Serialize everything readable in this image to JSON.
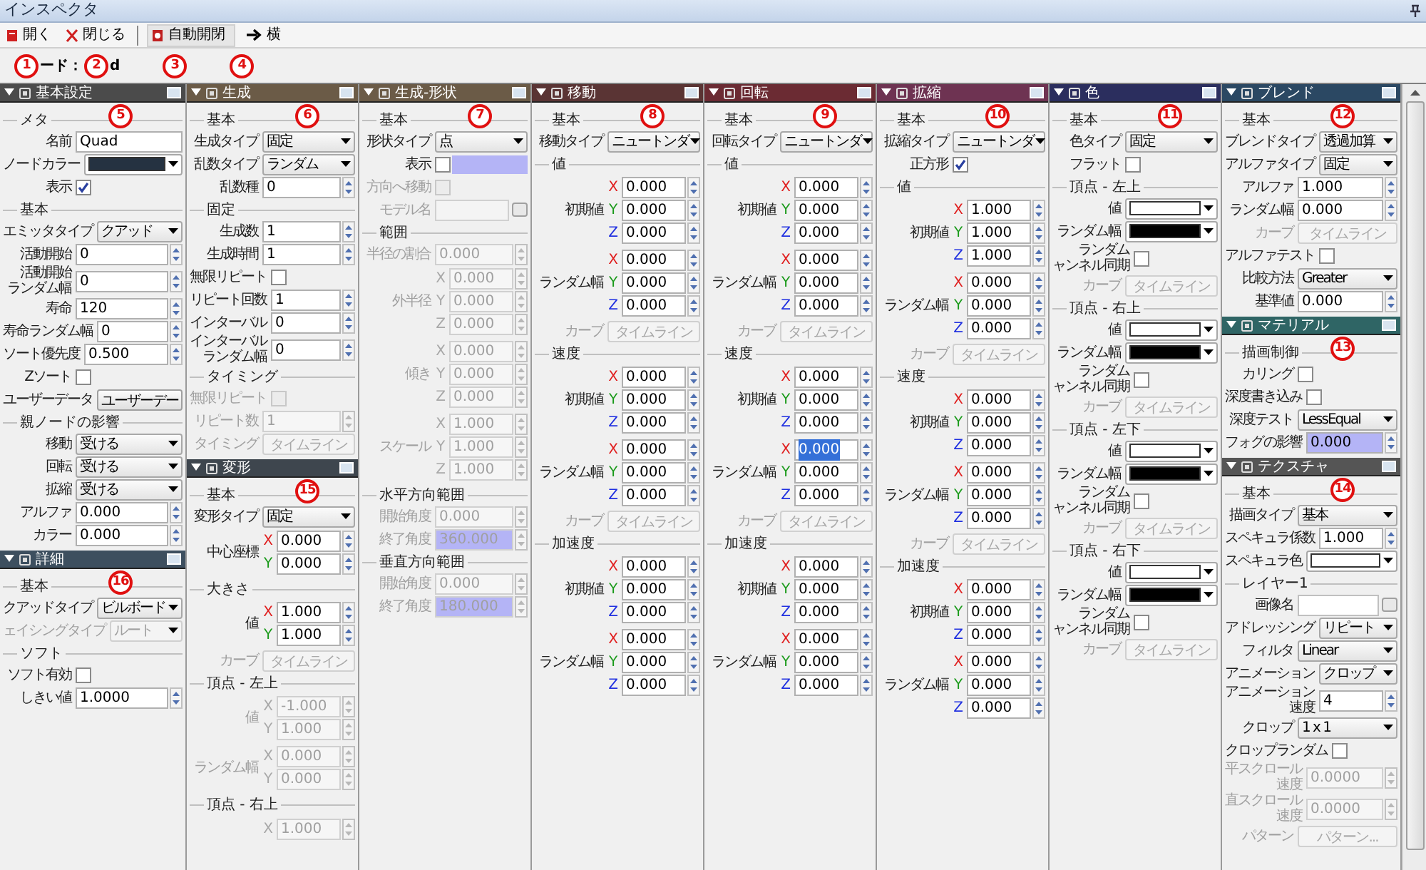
{
  "window": {
    "title": "インスペクタ"
  },
  "toolbar": [
    {
      "label": "開く",
      "kind": "open"
    },
    {
      "label": "閉じる",
      "kind": "close"
    },
    {
      "label": "自動開閉",
      "kind": "auto"
    },
    {
      "label": "横",
      "kind": "arrow"
    }
  ],
  "node_row": [
    {
      "kind": "callout",
      "text": "1"
    },
    {
      "kind": "text",
      "text": "ード："
    },
    {
      "kind": "callout",
      "text": "2"
    },
    {
      "kind": "text",
      "text": "d"
    },
    {
      "kind": "callout",
      "text": "3"
    },
    {
      "kind": "callout",
      "text": "4"
    }
  ],
  "columns": [
    {
      "panels": [
        {
          "title": "基本設定",
          "callout": "5",
          "color": "#4b4b4b",
          "expanded": true,
          "sections": [
            {
              "heading": "メタ",
              "rows": [
                {
                  "kind": "text",
                  "label": "名前",
                  "value": "Quad"
                },
                {
                  "kind": "color",
                  "label": "ノードカラー",
                  "color": "#253241"
                },
                {
                  "kind": "check",
                  "label": "表示",
                  "checked": true
                }
              ]
            },
            {
              "heading": "基本",
              "rows": [
                {
                  "kind": "select",
                  "label": "エミッタタイプ",
                  "value": "クアッド"
                },
                {
                  "kind": "spin",
                  "label": "活動開始",
                  "value": "0"
                },
                {
                  "kind": "spin",
                  "label": [
                    "活動開始",
                    "ランダム幅"
                  ],
                  "value": "0"
                },
                {
                  "kind": "spin",
                  "label": "寿命",
                  "value": "120"
                },
                {
                  "kind": "spin",
                  "label": "寿命ランダム幅",
                  "value": "0"
                },
                {
                  "kind": "spin",
                  "label": "ソート優先度",
                  "value": "0.500"
                },
                {
                  "kind": "check",
                  "label": "Zソート",
                  "checked": false
                },
                {
                  "kind": "button",
                  "label": "ユーザーデータ",
                  "value": "ユーザーデー"
                }
              ]
            },
            {
              "heading": "親ノードの影響",
              "rows": [
                {
                  "kind": "select",
                  "label": "移動",
                  "value": "受ける"
                },
                {
                  "kind": "select",
                  "label": "回転",
                  "value": "受ける"
                },
                {
                  "kind": "select",
                  "label": "拡縮",
                  "value": "受ける"
                },
                {
                  "kind": "spin",
                  "label": "アルファ",
                  "value": "0.000"
                },
                {
                  "kind": "spin",
                  "label": "カラー",
                  "value": "0.000"
                }
              ]
            }
          ]
        },
        {
          "title": "詳細",
          "callout": "16",
          "color": "#3d4f5f",
          "expanded": true,
          "sections": [
            {
              "heading": "基本",
              "rows": [
                {
                  "kind": "select",
                  "label": "クアッドタイプ",
                  "value": "ビルボード"
                },
                {
                  "kind": "select",
                  "label": "ェイシングタイプ",
                  "value": "ルート",
                  "disabled": true
                }
              ]
            },
            {
              "heading": "ソフト",
              "rows": [
                {
                  "kind": "check",
                  "label": "ソフト有効",
                  "checked": false
                },
                {
                  "kind": "spin",
                  "label": "しきい値",
                  "value": "1.0000"
                }
              ]
            }
          ]
        }
      ]
    },
    {
      "panels": [
        {
          "title": "生成",
          "callout": "6",
          "color": "#6b5b47",
          "expanded": true,
          "sections": [
            {
              "heading": "基本",
              "rows": [
                {
                  "kind": "select",
                  "label": "生成タイプ",
                  "value": "固定"
                },
                {
                  "kind": "select",
                  "label": "乱数タイプ",
                  "value": "ランダム"
                },
                {
                  "kind": "spin",
                  "label": "乱数種",
                  "value": "0"
                }
              ]
            },
            {
              "heading": "固定",
              "rows": [
                {
                  "kind": "spin",
                  "label": "生成数",
                  "value": "1"
                },
                {
                  "kind": "spin",
                  "label": "生成時間",
                  "value": "1"
                },
                {
                  "kind": "check",
                  "label": "無限リピート",
                  "checked": false
                },
                {
                  "kind": "spin",
                  "label": "リピート回数",
                  "value": "1"
                },
                {
                  "kind": "spin",
                  "label": "インターバル",
                  "value": "0"
                },
                {
                  "kind": "spin",
                  "label": [
                    "インターバル",
                    "ランダム幅"
                  ],
                  "value": "0"
                }
              ]
            },
            {
              "heading": "タイミング",
              "rows": [
                {
                  "kind": "check",
                  "label": "無限リピート",
                  "checked": false,
                  "disabled": true
                },
                {
                  "kind": "spin",
                  "label": "リピート数",
                  "value": "1",
                  "disabled": true
                },
                {
                  "kind": "button",
                  "label": "タイミング",
                  "value": "タイムライン",
                  "disabled": true
                }
              ]
            }
          ]
        },
        {
          "title": "変形",
          "callout": "15",
          "color": "#3e464e",
          "expanded": true,
          "sections": [
            {
              "heading": "基本",
              "rows": [
                {
                  "kind": "select",
                  "label": "変形タイプ",
                  "value": "固定"
                },
                {
                  "kind": "xyz",
                  "label": "中心座標",
                  "axes": [
                    {
                      "axis": "X",
                      "value": "0.000"
                    },
                    {
                      "axis": "Y",
                      "value": "0.000"
                    }
                  ]
                }
              ]
            },
            {
              "heading": "大きさ",
              "rows": [
                {
                  "kind": "xyz",
                  "label": "値",
                  "axes": [
                    {
                      "axis": "X",
                      "value": "1.000"
                    },
                    {
                      "axis": "Y",
                      "value": "1.000"
                    }
                  ]
                },
                {
                  "kind": "button",
                  "label": "カーブ",
                  "value": "タイムライン",
                  "disabled": true
                }
              ]
            },
            {
              "heading": "頂点 - 左上",
              "rows": [
                {
                  "kind": "xyz",
                  "label": "値",
                  "disabled": true,
                  "axes": [
                    {
                      "axis": "X",
                      "value": "-1.000"
                    },
                    {
                      "axis": "Y",
                      "value": "1.000"
                    }
                  ]
                },
                {
                  "kind": "xyz",
                  "label": "ランダム幅",
                  "disabled": true,
                  "axes": [
                    {
                      "axis": "X",
                      "value": "0.000"
                    },
                    {
                      "axis": "Y",
                      "value": "0.000"
                    }
                  ]
                }
              ]
            },
            {
              "heading": "頂点 - 右上",
              "rows": [
                {
                  "kind": "xyz",
                  "disabled": true,
                  "axes": [
                    {
                      "axis": "X",
                      "value": "1.000"
                    }
                  ]
                }
              ]
            }
          ]
        }
      ]
    },
    {
      "panels": [
        {
          "title": "生成-形状",
          "callout": "7",
          "color": "#6b5b47",
          "expanded": true,
          "sections": [
            {
              "heading": "基本",
              "rows": [
                {
                  "kind": "select",
                  "label": "形状タイプ",
                  "value": "点"
                },
                {
                  "kind": "check",
                  "label": "表示",
                  "checked": false,
                  "highlighted": true
                },
                {
                  "kind": "check",
                  "label": "方向へ移動",
                  "checked": false,
                  "disabled": true
                },
                {
                  "kind": "file",
                  "label": "モデル名",
                  "disabled": true
                }
              ]
            },
            {
              "heading": "範囲",
              "rows": [
                {
                  "kind": "spin",
                  "label": "半径の割合",
                  "value": "0.000",
                  "disabled": true
                },
                {
                  "kind": "xyz",
                  "label": "外半径",
                  "disabled": true,
                  "axes": [
                    {
                      "axis": "X",
                      "value": "0.000"
                    },
                    {
                      "axis": "Y",
                      "value": "0.000"
                    },
                    {
                      "axis": "Z",
                      "value": "0.000"
                    }
                  ]
                },
                {
                  "kind": "xyz",
                  "label": "傾き",
                  "disabled": true,
                  "axes": [
                    {
                      "axis": "X",
                      "value": "0.000"
                    },
                    {
                      "axis": "Y",
                      "value": "0.000"
                    },
                    {
                      "axis": "Z",
                      "value": "0.000"
                    }
                  ]
                },
                {
                  "kind": "xyz",
                  "label": "スケール",
                  "disabled": true,
                  "axes": [
                    {
                      "axis": "X",
                      "value": "1.000"
                    },
                    {
                      "axis": "Y",
                      "value": "1.000"
                    },
                    {
                      "axis": "Z",
                      "value": "1.000"
                    }
                  ]
                }
              ]
            },
            {
              "heading": "水平方向範囲",
              "rows": [
                {
                  "kind": "spin",
                  "label": "開始角度",
                  "value": "0.000",
                  "disabled": true
                },
                {
                  "kind": "spin",
                  "label": "終了角度",
                  "value": "360.000",
                  "disabled": true,
                  "highlighted": true
                }
              ]
            },
            {
              "heading": "垂直方向範囲",
              "rows": [
                {
                  "kind": "spin",
                  "label": "開始角度",
                  "value": "0.000",
                  "disabled": true
                },
                {
                  "kind": "spin",
                  "label": "終了角度",
                  "value": "180.000",
                  "disabled": true,
                  "highlighted": true
                }
              ]
            }
          ]
        }
      ]
    },
    {
      "panels": [
        {
          "title": "移動",
          "callout": "8",
          "color": "#5a3434",
          "expanded": true,
          "sections": [
            {
              "heading": "基本",
              "rows": [
                {
                  "kind": "select",
                  "label": "移動タイプ",
                  "value": "ニュートンダ"
                }
              ]
            },
            {
              "heading": "値",
              "rows": [
                {
                  "kind": "xyz",
                  "label": "初期値",
                  "axes": [
                    {
                      "axis": "X",
                      "value": "0.000"
                    },
                    {
                      "axis": "Y",
                      "value": "0.000"
                    },
                    {
                      "axis": "Z",
                      "value": "0.000"
                    }
                  ]
                },
                {
                  "kind": "xyz",
                  "label": "ランダム幅",
                  "axes": [
                    {
                      "axis": "X",
                      "value": "0.000"
                    },
                    {
                      "axis": "Y",
                      "value": "0.000"
                    },
                    {
                      "axis": "Z",
                      "value": "0.000"
                    }
                  ]
                },
                {
                  "kind": "button",
                  "label": "カーブ",
                  "value": "タイムライン",
                  "disabled": true
                }
              ]
            },
            {
              "heading": "速度",
              "rows": [
                {
                  "kind": "xyz",
                  "label": "初期値",
                  "axes": [
                    {
                      "axis": "X",
                      "value": "0.000"
                    },
                    {
                      "axis": "Y",
                      "value": "0.000"
                    },
                    {
                      "axis": "Z",
                      "value": "0.000"
                    }
                  ]
                },
                {
                  "kind": "xyz",
                  "label": "ランダム幅",
                  "axes": [
                    {
                      "axis": "X",
                      "value": "0.000"
                    },
                    {
                      "axis": "Y",
                      "value": "0.000"
                    },
                    {
                      "axis": "Z",
                      "value": "0.000"
                    }
                  ]
                },
                {
                  "kind": "button",
                  "label": "カーブ",
                  "value": "タイムライン",
                  "disabled": true
                }
              ]
            },
            {
              "heading": "加速度",
              "rows": [
                {
                  "kind": "xyz",
                  "label": "初期値",
                  "axes": [
                    {
                      "axis": "X",
                      "value": "0.000"
                    },
                    {
                      "axis": "Y",
                      "value": "0.000"
                    },
                    {
                      "axis": "Z",
                      "value": "0.000"
                    }
                  ]
                },
                {
                  "kind": "xyz",
                  "label": "ランダム幅",
                  "axes": [
                    {
                      "axis": "X",
                      "value": "0.000"
                    },
                    {
                      "axis": "Y",
                      "value": "0.000"
                    },
                    {
                      "axis": "Z",
                      "value": "0.000"
                    }
                  ]
                }
              ]
            }
          ]
        }
      ]
    },
    {
      "panels": [
        {
          "title": "回転",
          "callout": "9",
          "color": "#6b2b33",
          "expanded": true,
          "sections": [
            {
              "heading": "基本",
              "rows": [
                {
                  "kind": "select",
                  "label": "回転タイプ",
                  "value": "ニュートンダ"
                }
              ]
            },
            {
              "heading": "値",
              "rows": [
                {
                  "kind": "xyz",
                  "label": "初期値",
                  "axes": [
                    {
                      "axis": "X",
                      "value": "0.000"
                    },
                    {
                      "axis": "Y",
                      "value": "0.000"
                    },
                    {
                      "axis": "Z",
                      "value": "0.000"
                    }
                  ]
                },
                {
                  "kind": "xyz",
                  "label": "ランダム幅",
                  "axes": [
                    {
                      "axis": "X",
                      "value": "0.000"
                    },
                    {
                      "axis": "Y",
                      "value": "0.000"
                    },
                    {
                      "axis": "Z",
                      "value": "0.000"
                    }
                  ]
                },
                {
                  "kind": "button",
                  "label": "カーブ",
                  "value": "タイムライン",
                  "disabled": true
                }
              ]
            },
            {
              "heading": "速度",
              "rows": [
                {
                  "kind": "xyz",
                  "label": "初期値",
                  "axes": [
                    {
                      "axis": "X",
                      "value": "0.000"
                    },
                    {
                      "axis": "Y",
                      "value": "0.000"
                    },
                    {
                      "axis": "Z",
                      "value": "0.000"
                    }
                  ]
                },
                {
                  "kind": "xyz",
                  "label": "ランダム幅",
                  "axes": [
                    {
                      "axis": "X",
                      "value": "0.000",
                      "selected": true
                    },
                    {
                      "axis": "Y",
                      "value": "0.000"
                    },
                    {
                      "axis": "Z",
                      "value": "0.000"
                    }
                  ]
                },
                {
                  "kind": "button",
                  "label": "カーブ",
                  "value": "タイムライン",
                  "disabled": true
                }
              ]
            },
            {
              "heading": "加速度",
              "rows": [
                {
                  "kind": "xyz",
                  "label": "初期値",
                  "axes": [
                    {
                      "axis": "X",
                      "value": "0.000"
                    },
                    {
                      "axis": "Y",
                      "value": "0.000"
                    },
                    {
                      "axis": "Z",
                      "value": "0.000"
                    }
                  ]
                },
                {
                  "kind": "xyz",
                  "label": "ランダム幅",
                  "axes": [
                    {
                      "axis": "X",
                      "value": "0.000"
                    },
                    {
                      "axis": "Y",
                      "value": "0.000"
                    },
                    {
                      "axis": "Z",
                      "value": "0.000"
                    }
                  ]
                }
              ]
            }
          ]
        }
      ]
    },
    {
      "panels": [
        {
          "title": "拡縮",
          "callout": "10",
          "color": "#6e3352",
          "expanded": true,
          "sections": [
            {
              "heading": "基本",
              "rows": [
                {
                  "kind": "select",
                  "label": "拡縮タイプ",
                  "value": "ニュートンダ"
                },
                {
                  "kind": "check",
                  "label": "正方形",
                  "checked": true
                }
              ]
            },
            {
              "heading": "値",
              "rows": [
                {
                  "kind": "xyz",
                  "label": "初期値",
                  "axes": [
                    {
                      "axis": "X",
                      "value": "1.000"
                    },
                    {
                      "axis": "Y",
                      "value": "1.000"
                    },
                    {
                      "axis": "Z",
                      "value": "1.000"
                    }
                  ]
                },
                {
                  "kind": "xyz",
                  "label": "ランダム幅",
                  "axes": [
                    {
                      "axis": "X",
                      "value": "0.000"
                    },
                    {
                      "axis": "Y",
                      "value": "0.000"
                    },
                    {
                      "axis": "Z",
                      "value": "0.000"
                    }
                  ]
                },
                {
                  "kind": "button",
                  "label": "カーブ",
                  "value": "タイムライン",
                  "disabled": true
                }
              ]
            },
            {
              "heading": "速度",
              "rows": [
                {
                  "kind": "xyz",
                  "label": "初期値",
                  "axes": [
                    {
                      "axis": "X",
                      "value": "0.000"
                    },
                    {
                      "axis": "Y",
                      "value": "0.000"
                    },
                    {
                      "axis": "Z",
                      "value": "0.000"
                    }
                  ]
                },
                {
                  "kind": "xyz",
                  "label": "ランダム幅",
                  "axes": [
                    {
                      "axis": "X",
                      "value": "0.000"
                    },
                    {
                      "axis": "Y",
                      "value": "0.000"
                    },
                    {
                      "axis": "Z",
                      "value": "0.000"
                    }
                  ]
                },
                {
                  "kind": "button",
                  "label": "カーブ",
                  "value": "タイムライン",
                  "disabled": true
                }
              ]
            },
            {
              "heading": "加速度",
              "rows": [
                {
                  "kind": "xyz",
                  "label": "初期値",
                  "axes": [
                    {
                      "axis": "X",
                      "value": "0.000"
                    },
                    {
                      "axis": "Y",
                      "value": "0.000"
                    },
                    {
                      "axis": "Z",
                      "value": "0.000"
                    }
                  ]
                },
                {
                  "kind": "xyz",
                  "label": "ランダム幅",
                  "axes": [
                    {
                      "axis": "X",
                      "value": "0.000"
                    },
                    {
                      "axis": "Y",
                      "value": "0.000"
                    },
                    {
                      "axis": "Z",
                      "value": "0.000"
                    }
                  ]
                }
              ]
            }
          ]
        }
      ]
    },
    {
      "panels": [
        {
          "title": "色",
          "callout": "11",
          "color": "#2b2e5e",
          "expanded": true,
          "sections": [
            {
              "heading": "基本",
              "rows": [
                {
                  "kind": "select",
                  "label": "色タイプ",
                  "value": "固定"
                },
                {
                  "kind": "check",
                  "label": "フラット",
                  "checked": false
                }
              ]
            },
            {
              "heading": "頂点 - 左上",
              "rows": [
                {
                  "kind": "color",
                  "label": "値",
                  "color": "#ffffff"
                },
                {
                  "kind": "color",
                  "label": "ランダム幅",
                  "color": "#000000"
                },
                {
                  "kind": "check",
                  "label": [
                    "ランダム",
                    "ャンネル同期"
                  ],
                  "checked": false
                },
                {
                  "kind": "button",
                  "label": "カーブ",
                  "value": "タイムライン",
                  "disabled": true
                }
              ]
            },
            {
              "heading": "頂点 - 右上",
              "rows": [
                {
                  "kind": "color",
                  "label": "値",
                  "color": "#ffffff"
                },
                {
                  "kind": "color",
                  "label": "ランダム幅",
                  "color": "#000000"
                },
                {
                  "kind": "check",
                  "label": [
                    "ランダム",
                    "ャンネル同期"
                  ],
                  "checked": false
                },
                {
                  "kind": "button",
                  "label": "カーブ",
                  "value": "タイムライン",
                  "disabled": true
                }
              ]
            },
            {
              "heading": "頂点 - 左下",
              "rows": [
                {
                  "kind": "color",
                  "label": "値",
                  "color": "#ffffff"
                },
                {
                  "kind": "color",
                  "label": "ランダム幅",
                  "color": "#000000"
                },
                {
                  "kind": "check",
                  "label": [
                    "ランダム",
                    "ャンネル同期"
                  ],
                  "checked": false
                },
                {
                  "kind": "button",
                  "label": "カーブ",
                  "value": "タイムライン",
                  "disabled": true
                }
              ]
            },
            {
              "heading": "頂点 - 右下",
              "rows": [
                {
                  "kind": "color",
                  "label": "値",
                  "color": "#ffffff"
                },
                {
                  "kind": "color",
                  "label": "ランダム幅",
                  "color": "#000000"
                },
                {
                  "kind": "check",
                  "label": [
                    "ランダム",
                    "ャンネル同期"
                  ],
                  "checked": false
                },
                {
                  "kind": "button",
                  "label": "カーブ",
                  "value": "タイムライン",
                  "disabled": true
                }
              ]
            }
          ]
        }
      ]
    },
    {
      "panels": [
        {
          "title": "ブレンド",
          "callout": "12",
          "color": "#2b4863",
          "expanded": true,
          "sections": [
            {
              "heading": "基本",
              "rows": [
                {
                  "kind": "select",
                  "label": "ブレンドタイプ",
                  "value": "透過加算"
                },
                {
                  "kind": "select",
                  "label": "アルファタイプ",
                  "value": "固定"
                },
                {
                  "kind": "spin",
                  "label": "アルファ",
                  "value": "1.000"
                },
                {
                  "kind": "spin",
                  "label": "ランダム幅",
                  "value": "0.000"
                },
                {
                  "kind": "button",
                  "label": "カーブ",
                  "value": "タイムライン",
                  "disabled": true
                },
                {
                  "kind": "check",
                  "label": "アルファテスト",
                  "checked": false
                },
                {
                  "kind": "select",
                  "label": "比較方法",
                  "value": "Greater"
                },
                {
                  "kind": "spin",
                  "label": "基準値",
                  "value": "0.000"
                }
              ]
            }
          ]
        },
        {
          "title": "マテリアル",
          "callout": "13",
          "color": "#2f6565",
          "expanded": true,
          "sections": [
            {
              "heading": "描画制御",
              "rows": [
                {
                  "kind": "check",
                  "label": "カリング",
                  "checked": false
                },
                {
                  "kind": "check",
                  "label": "深度書き込み",
                  "checked": false
                },
                {
                  "kind": "select",
                  "label": "深度テスト",
                  "value": "LessEqual"
                },
                {
                  "kind": "spin",
                  "label": "フォグの影響",
                  "value": "0.000",
                  "highlighted": true
                }
              ]
            }
          ]
        },
        {
          "title": "テクスチャ",
          "callout": "14",
          "color": "#555555",
          "expanded": true,
          "sections": [
            {
              "heading": "基本",
              "rows": [
                {
                  "kind": "select",
                  "label": "描画タイプ",
                  "value": "基本"
                },
                {
                  "kind": "spin",
                  "label": "スペキュラ係数",
                  "value": "1.000"
                },
                {
                  "kind": "color",
                  "label": "スペキュラ色",
                  "color": "#ffffff"
                }
              ]
            },
            {
              "heading": "レイヤー1",
              "rows": [
                {
                  "kind": "file",
                  "label": "画像名"
                },
                {
                  "kind": "select",
                  "label": "アドレッシング",
                  "value": "リピート"
                },
                {
                  "kind": "select",
                  "label": "フィルタ",
                  "value": "Linear"
                },
                {
                  "kind": "select",
                  "label": "アニメーション",
                  "value": "クロップ"
                },
                {
                  "kind": "spin",
                  "label": [
                    "アニメーション",
                    "速度"
                  ],
                  "value": "4"
                },
                {
                  "kind": "select",
                  "label": "クロップ",
                  "value": "1 x 1"
                },
                {
                  "kind": "check",
                  "label": "クロップランダム",
                  "checked": false
                },
                {
                  "kind": "spin",
                  "label": [
                    "平スクロール",
                    "速度"
                  ],
                  "value": "0.0000",
                  "disabled": true
                },
                {
                  "kind": "spin",
                  "label": [
                    "直スクロール",
                    "速度"
                  ],
                  "value": "0.0000",
                  "disabled": true
                },
                {
                  "kind": "button",
                  "label": "パターン",
                  "value": "パターン...",
                  "disabled": true
                }
              ]
            }
          ]
        }
      ]
    }
  ]
}
